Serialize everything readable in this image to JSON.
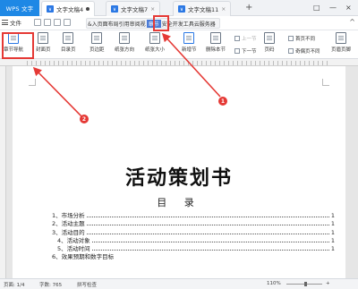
{
  "titlebar": {
    "app_button": "WPS 文字",
    "tabs": [
      {
        "label": "文字文稿4",
        "state": "modified"
      },
      {
        "label": "文字文稿7",
        "state": "close"
      },
      {
        "label": "文字文稿11",
        "state": "close"
      }
    ],
    "add_tab": "+",
    "window_controls": [
      "□",
      "—",
      "×"
    ]
  },
  "menubar": {
    "file_label": "文件",
    "ribbon_tabs_left": "&入页面布局引用审阅视",
    "ribbon_tabs_active": "章节",
    "ribbon_tabs_right": "安全开发工具云服务器",
    "collapse_icon": "^"
  },
  "ribbon": {
    "buttons": [
      {
        "label": "章节导航"
      },
      {
        "label": "封面页"
      },
      {
        "label": "目录页"
      },
      {
        "label": "页边距"
      },
      {
        "label": "纸张方向"
      },
      {
        "label": "纸张大小"
      },
      {
        "label": "新增节"
      },
      {
        "label": "删除本节"
      },
      {
        "label": "页码"
      },
      {
        "label": "页眉页脚"
      }
    ],
    "prev_section": "上一节",
    "next_section": "下一节",
    "first_page_diff": "首页不同",
    "odd_even_diff": "奇偶页不同"
  },
  "document": {
    "title": "活动策划书",
    "toc_heading": "目 录",
    "toc": [
      {
        "label": "1、市场分析",
        "page": "1"
      },
      {
        "label": "2、活动主题",
        "page": "1"
      },
      {
        "label": "3、活动目的",
        "page": "1"
      },
      {
        "label": "4、活动对象",
        "page": "1"
      },
      {
        "label": "5、活动时间",
        "page": "1"
      },
      {
        "label": "6、效果预期和数字目标",
        "page": ""
      }
    ]
  },
  "statusbar": {
    "page": "页面: 1/4",
    "words": "字数: 765",
    "spellcheck": "拼写检查",
    "zoom": "110%",
    "zoom_level": 0.55
  },
  "annotations": {
    "badge1": "1",
    "badge2": "2",
    "color": "#e53935"
  }
}
